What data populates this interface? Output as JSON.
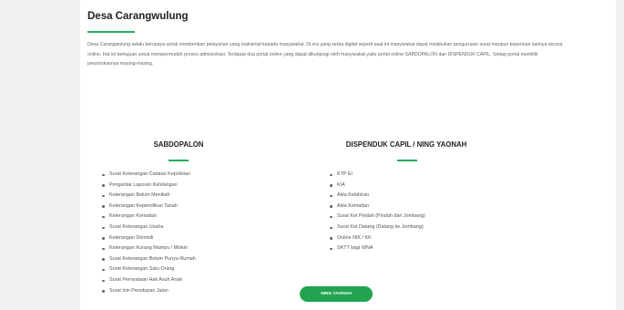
{
  "title": "Desa Carangwulung",
  "intro": "Desa Carangwulung selalu berupaya untuk memberikan pelayanan yang maksimal kepada masyarakat. Di era yang serba digital seperti saat ini masyarakat dapat melakukan pengurusan surat maupun keperluan lainnya secara online. Hal ini bertujuan untuk mempermudah proses administrasi. Terdapat dua portal online yang dapat dikunjungi oleh masyarakat yaitu portal online SABDOPALON dan DISPENDUK CAPIL. Setiap portal memiliki peruntukannya masing-masing.",
  "left": {
    "heading": "SABDOPALON",
    "items": [
      "Surat Keterangan Catatan Kepolisian",
      "Pengantar Laporan Kehilangan",
      "Keterangan Belum Menikah",
      "Keterangan Kepemilikan Tanah",
      "Keterangan Kematian",
      "Surat Keterangan Usaha",
      "Keterangan Domisili",
      "Keterangan Kurang Mampu / Miskin",
      "Surat Keterangan Belum Punya Rumah",
      "Surat Keterangan Satu Orang",
      "Surat Pernyataan Hak Asuh Anak",
      "Surat Izin Penutupan Jalan"
    ]
  },
  "right": {
    "heading": "DISPENDUK CAPIL / NING YAONAH",
    "items": [
      "KTP El",
      "KIA",
      "Akta Kelahiran",
      "Akta Kematian",
      "Surat Ket Pindah (Pindah dari Jombang)",
      "Surat Ket Datang (Datang ke Jombang)",
      "Online NIK / KK",
      "SKTT bagi WNA"
    ],
    "button_label": "NING YAONAH"
  },
  "colors": {
    "accent": "#27ae60",
    "button": "#22a34f",
    "background": "#f1f1f1",
    "card": "#ffffff"
  }
}
